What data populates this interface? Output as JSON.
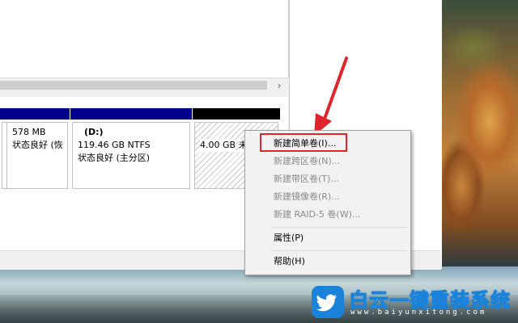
{
  "disk_map": {
    "partitions": [
      {
        "label": "",
        "size": "",
        "status": ""
      },
      {
        "label": "",
        "size": "578 MB",
        "status": "状态良好 (恢"
      },
      {
        "label": "(D:)",
        "size": "119.46 GB NTFS",
        "status": "状态良好 (主分区)"
      },
      {
        "label": "",
        "size": "4.00 GB",
        "status": "未分配"
      }
    ]
  },
  "scrollbar": {
    "arrow_glyph": "›"
  },
  "context_menu": {
    "items": [
      {
        "label": "新建简单卷(I)...",
        "enabled": true
      },
      {
        "label": "新建跨区卷(N)...",
        "enabled": false
      },
      {
        "label": "新建带区卷(T)...",
        "enabled": false
      },
      {
        "label": "新建镜像卷(R)...",
        "enabled": false
      },
      {
        "label": "新建 RAID-5 卷(W)...",
        "enabled": false
      },
      {
        "label": "属性(P)",
        "enabled": true
      },
      {
        "label": "帮助(H)",
        "enabled": true
      }
    ]
  },
  "watermark": {
    "title": "白云一键重装系统",
    "url": "www.baiyunxitong.com",
    "logo_icon": "twitter-bird-icon"
  },
  "colors": {
    "partition_bar": "#00008b",
    "unallocated_bar": "#000000",
    "highlight": "#e0242b",
    "logo_blue": "#1a82d9"
  }
}
